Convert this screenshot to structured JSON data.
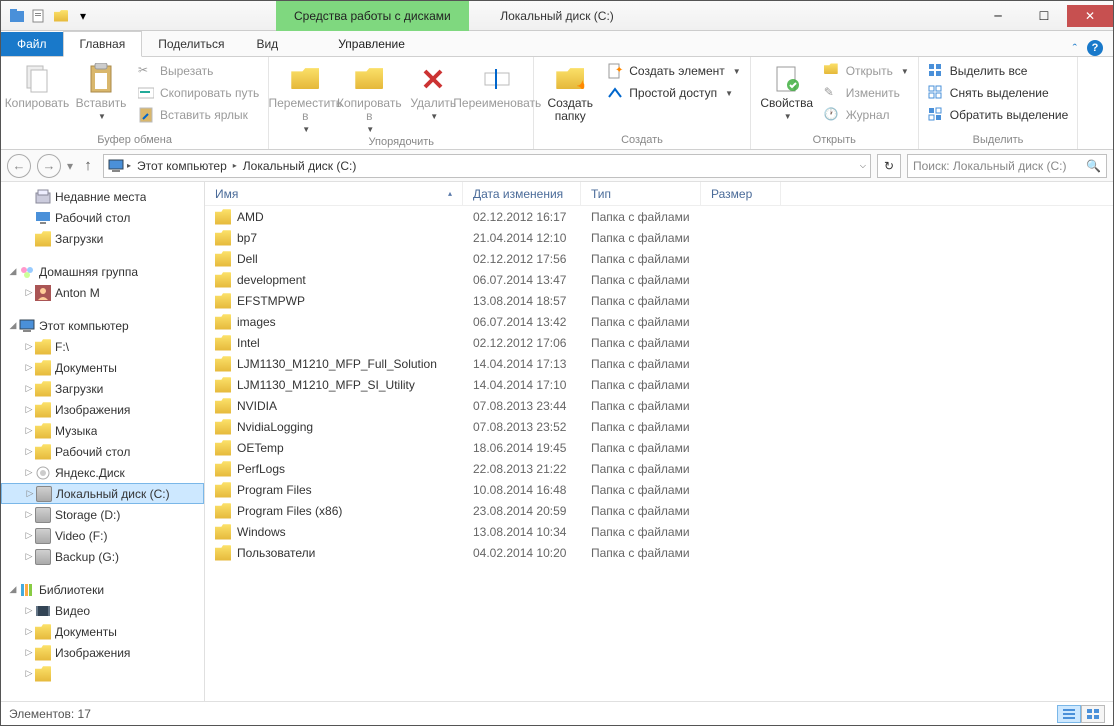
{
  "window": {
    "title": "Локальный диск (C:)",
    "context_tab_header": "Средства работы с дисками"
  },
  "ribbon_tabs": {
    "file": "Файл",
    "home": "Главная",
    "share": "Поделиться",
    "view": "Вид",
    "manage": "Управление"
  },
  "ribbon": {
    "clipboard": {
      "copy": "Копировать",
      "paste": "Вставить",
      "cut": "Вырезать",
      "copy_path": "Скопировать путь",
      "paste_shortcut": "Вставить ярлык",
      "label": "Буфер обмена"
    },
    "organize": {
      "move_to": "Переместить в",
      "copy_to": "Копировать в",
      "delete": "Удалить",
      "rename": "Переименовать",
      "label": "Упорядочить"
    },
    "new": {
      "new_folder": "Создать папку",
      "new_item": "Создать элемент",
      "easy_access": "Простой доступ",
      "label": "Создать"
    },
    "open": {
      "properties": "Свойства",
      "open": "Открыть",
      "edit": "Изменить",
      "history": "Журнал",
      "label": "Открыть"
    },
    "select": {
      "select_all": "Выделить все",
      "select_none": "Снять выделение",
      "invert": "Обратить выделение",
      "label": "Выделить"
    }
  },
  "nav": {
    "breadcrumb": [
      "Этот компьютер",
      "Локальный диск (C:)"
    ],
    "search_placeholder": "Поиск: Локальный диск (C:)"
  },
  "columns": {
    "name": "Имя",
    "date": "Дата изменения",
    "type": "Тип",
    "size": "Размер"
  },
  "files": [
    {
      "name": "AMD",
      "date": "02.12.2012 16:17",
      "type": "Папка с файлами",
      "size": ""
    },
    {
      "name": "bp7",
      "date": "21.04.2014 12:10",
      "type": "Папка с файлами",
      "size": ""
    },
    {
      "name": "Dell",
      "date": "02.12.2012 17:56",
      "type": "Папка с файлами",
      "size": ""
    },
    {
      "name": "development",
      "date": "06.07.2014 13:47",
      "type": "Папка с файлами",
      "size": ""
    },
    {
      "name": "EFSTMPWP",
      "date": "13.08.2014 18:57",
      "type": "Папка с файлами",
      "size": ""
    },
    {
      "name": "images",
      "date": "06.07.2014 13:42",
      "type": "Папка с файлами",
      "size": ""
    },
    {
      "name": "Intel",
      "date": "02.12.2012 17:06",
      "type": "Папка с файлами",
      "size": ""
    },
    {
      "name": "LJM1130_M1210_MFP_Full_Solution",
      "date": "14.04.2014 17:13",
      "type": "Папка с файлами",
      "size": ""
    },
    {
      "name": "LJM1130_M1210_MFP_SI_Utility",
      "date": "14.04.2014 17:10",
      "type": "Папка с файлами",
      "size": ""
    },
    {
      "name": "NVIDIA",
      "date": "07.08.2013 23:44",
      "type": "Папка с файлами",
      "size": ""
    },
    {
      "name": "NvidiaLogging",
      "date": "07.08.2013 23:52",
      "type": "Папка с файлами",
      "size": ""
    },
    {
      "name": "OETemp",
      "date": "18.06.2014 19:45",
      "type": "Папка с файлами",
      "size": ""
    },
    {
      "name": "PerfLogs",
      "date": "22.08.2013 21:22",
      "type": "Папка с файлами",
      "size": ""
    },
    {
      "name": "Program Files",
      "date": "10.08.2014 16:48",
      "type": "Папка с файлами",
      "size": ""
    },
    {
      "name": "Program Files (x86)",
      "date": "23.08.2014 20:59",
      "type": "Папка с файлами",
      "size": ""
    },
    {
      "name": "Windows",
      "date": "13.08.2014 10:34",
      "type": "Папка с файлами",
      "size": ""
    },
    {
      "name": "Пользователи",
      "date": "04.02.2014 10:20",
      "type": "Папка с файлами",
      "size": ""
    }
  ],
  "sidebar": {
    "recent": "Недавние места",
    "desktop": "Рабочий стол",
    "downloads": "Загрузки",
    "homegroup": "Домашняя группа",
    "anton": "Anton M",
    "this_pc": "Этот компьютер",
    "f_drive": "F:\\",
    "documents": "Документы",
    "downloads2": "Загрузки",
    "pictures": "Изображения",
    "music": "Музыка",
    "desktop2": "Рабочий стол",
    "yandex": "Яндекс.Диск",
    "cdrive": "Локальный диск (C:)",
    "storage": "Storage (D:)",
    "video_f": "Video (F:)",
    "backup": "Backup (G:)",
    "libraries": "Библиотеки",
    "video": "Видео",
    "documents2": "Документы",
    "pictures2": "Изображения"
  },
  "status": {
    "count_label": "Элементов: 17"
  }
}
